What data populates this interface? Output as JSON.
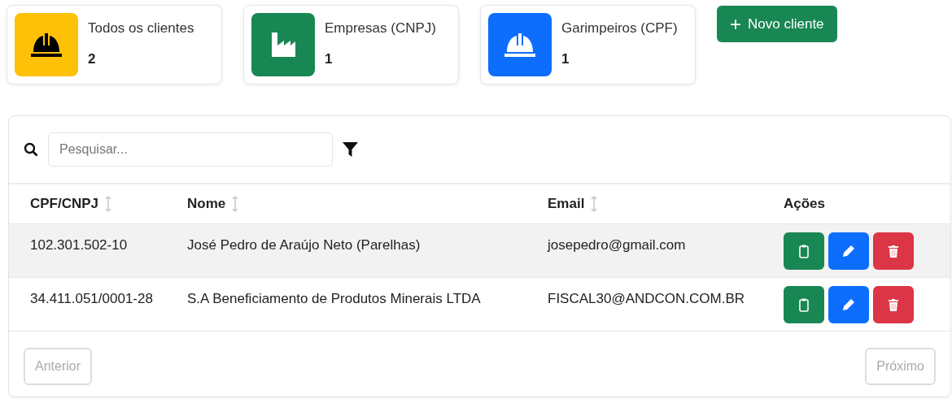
{
  "stats": [
    {
      "label": "Todos os clientes",
      "count": "2",
      "color": "#ffc107",
      "kind": "helmet"
    },
    {
      "label": "Empresas (CNPJ)",
      "count": "1",
      "color": "#198754",
      "kind": "factory"
    },
    {
      "label": "Garimpeiros (CPF)",
      "count": "1",
      "color": "#0d6efd",
      "kind": "helmet"
    }
  ],
  "new_button": {
    "icon": "+",
    "label": "Novo cliente"
  },
  "search": {
    "placeholder": "Pesquisar..."
  },
  "table": {
    "columns": [
      {
        "label": "CPF/CNPJ",
        "sortable": true
      },
      {
        "label": "Nome",
        "sortable": true
      },
      {
        "label": "Email",
        "sortable": true
      },
      {
        "label": "Ações",
        "sortable": false
      }
    ],
    "rows": [
      {
        "cells": [
          "102.301.502-10",
          "José Pedro de Araújo Neto (Parelhas)",
          "josepedro@gmail.com"
        ],
        "actions": [
          {
            "kind": "clipboard"
          },
          {
            "kind": "edit"
          },
          {
            "kind": "delete"
          }
        ]
      },
      {
        "cells": [
          "34.411.051/0001-28",
          "S.A Beneficiamento de Produtos Minerais LTDA",
          "FISCAL30@ANDCON.COM.BR"
        ],
        "actions": [
          {
            "kind": "clipboard"
          },
          {
            "kind": "edit"
          },
          {
            "kind": "delete"
          }
        ]
      }
    ]
  },
  "pagination": [
    {
      "label": "Anterior",
      "disabled": true
    },
    {
      "label": "Próximo",
      "disabled": true
    }
  ]
}
